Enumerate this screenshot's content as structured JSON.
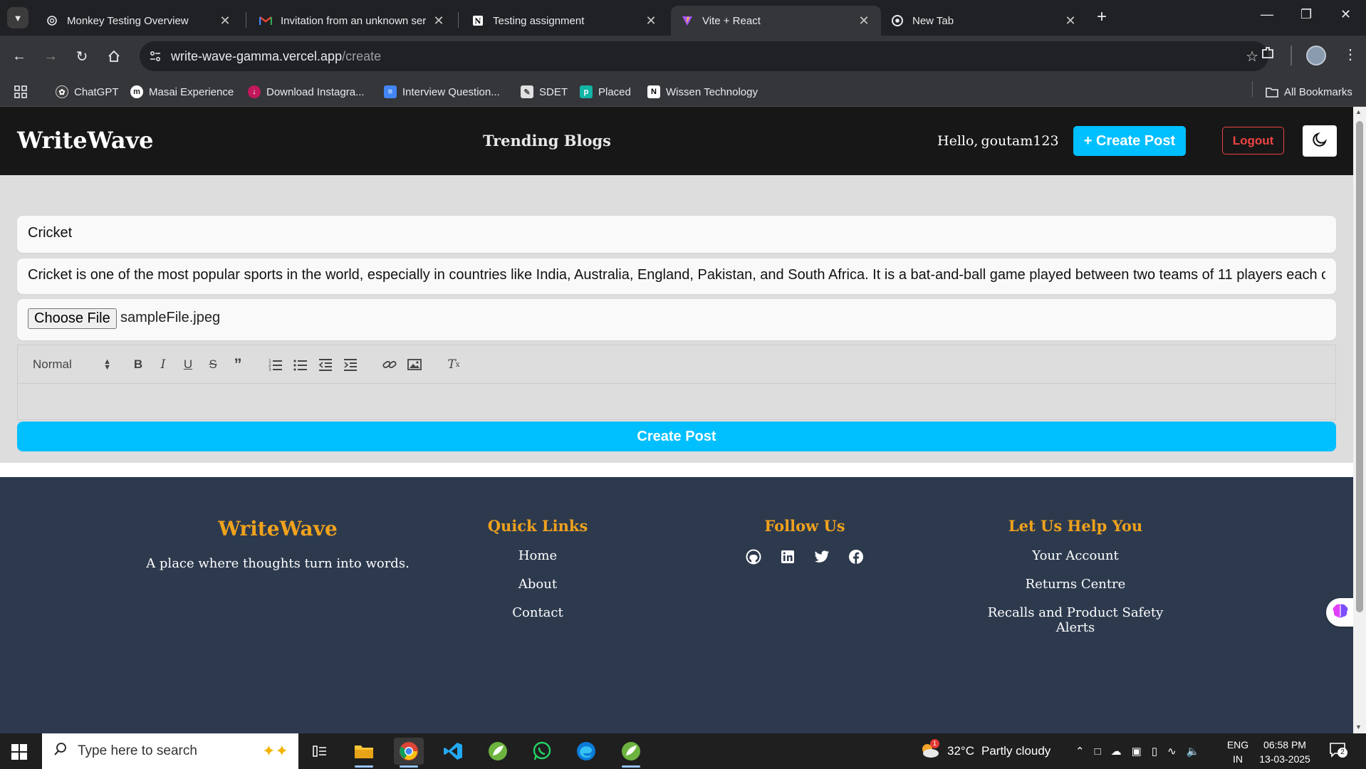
{
  "browser": {
    "tabs": [
      {
        "title": "Monkey Testing Overview",
        "icon": "chatgpt-icon",
        "active": false
      },
      {
        "title": "Invitation from an unknown ser",
        "icon": "gmail-icon",
        "active": false
      },
      {
        "title": "Testing assignment",
        "icon": "notion-icon",
        "active": false
      },
      {
        "title": "Vite + React",
        "icon": "vite-icon",
        "active": true
      },
      {
        "title": "New Tab",
        "icon": "chrome-icon",
        "active": false
      }
    ],
    "url_host": "write-wave-gamma.vercel.app",
    "url_path": "/create",
    "bookmarks": [
      {
        "label": "ChatGPT",
        "icon": "chatgpt-icon",
        "color": "#3c3c3c"
      },
      {
        "label": "Masai Experience",
        "icon": "masai-icon",
        "color": "#ffffff"
      },
      {
        "label": "Download Instagra...",
        "icon": "download-icon",
        "color": "#c2185b"
      },
      {
        "label": "Interview Question...",
        "icon": "doc-icon",
        "color": "#4285f4"
      },
      {
        "label": "SDET",
        "icon": "notepad-icon",
        "color": "#f4c20d"
      },
      {
        "label": "Placed",
        "icon": "placed-icon",
        "color": "#12b5a5"
      },
      {
        "label": "Wissen Technology",
        "icon": "notion-icon",
        "color": "#ffffff"
      }
    ],
    "all_bookmarks": "All Bookmarks"
  },
  "app": {
    "brand": "WriteWave",
    "nav_trending": "Trending Blogs",
    "greeting": "Hello,",
    "username": "goutam123",
    "create_post_top": "+ Create Post",
    "logout": "Logout",
    "accent": "#00bfff"
  },
  "form": {
    "title_value": "Cricket",
    "content_value": "Cricket is one of the most popular sports in the world, especially in countries like India, Australia, England, Pakistan, and South Africa. It is a bat-and-ball game played between two teams of 11 players each o",
    "choose_file": "Choose File",
    "file_name": "sampleFile.jpeg",
    "editor_format": "Normal",
    "submit": "Create Post"
  },
  "footer": {
    "brand": "WriteWave",
    "tagline": "A place where thoughts turn into words.",
    "quick_links_heading": "Quick Links",
    "quick_links": [
      "Home",
      "About",
      "Contact"
    ],
    "follow_heading": "Follow Us",
    "social_icons": [
      "github-icon",
      "linkedin-icon",
      "twitter-icon",
      "facebook-icon"
    ],
    "help_heading": "Let Us Help You",
    "help_links": [
      "Your Account",
      "Returns Centre",
      "Recalls and Product Safety Alerts"
    ],
    "accent": "#f0a21c"
  },
  "taskbar": {
    "search_placeholder": "Type here to search",
    "weather_temp": "32°C",
    "weather_desc": "Partly cloudy",
    "weather_alert": "1",
    "lang_1": "ENG",
    "lang_2": "IN",
    "time": "06:58 PM",
    "date": "13-03-2025",
    "notifications": "2"
  }
}
